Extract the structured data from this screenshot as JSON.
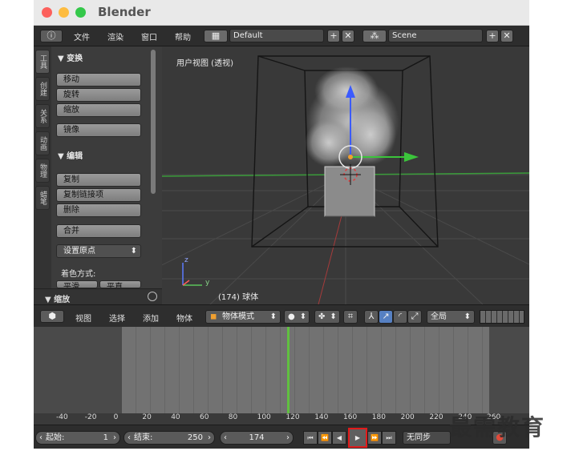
{
  "window": {
    "title": "Blender"
  },
  "info_header": {
    "menus": [
      "文件",
      "渲染",
      "窗口",
      "帮助"
    ],
    "layout": "Default",
    "scene": "Scene"
  },
  "tool_shelf": {
    "tabs": [
      "工具",
      "创建",
      "关系",
      "动画",
      "物理",
      "蜡笔"
    ],
    "transform_panel": {
      "title": "▼ 变换",
      "buttons": [
        "移动",
        "旋转",
        "缩放",
        "镜像"
      ]
    },
    "edit_panel": {
      "title": "▼ 编辑",
      "buttons": [
        "复制",
        "复制链接项",
        "删除",
        "合并"
      ],
      "set_origin": "设置原点",
      "shading_label": "着色方式:",
      "shading_buttons": [
        "平滑",
        "平直"
      ]
    },
    "last_operator": "▼ 缩放"
  },
  "viewport": {
    "view_label": "用户视图 (透视)",
    "object_label": "(174) 球体",
    "axis_z": "z",
    "axis_y": "y"
  },
  "view3d_header": {
    "menus": [
      "视图",
      "选择",
      "添加",
      "物体"
    ],
    "mode": "物体模式",
    "orientation": "全局"
  },
  "timeline": {
    "ticks": [
      "-40",
      "-20",
      "0",
      "20",
      "40",
      "60",
      "80",
      "100",
      "120",
      "140",
      "160",
      "180",
      "200",
      "220",
      "240",
      "260"
    ],
    "start_label": "起始:",
    "start_value": "1",
    "end_label": "结束:",
    "end_value": "250",
    "current_frame": "174",
    "sync": "无同步",
    "current_frame_fraction": 0.45
  },
  "watermark": "最需教育",
  "colors": {
    "selected_tool": "#5680c2",
    "highlight_box": "#e21b1b",
    "frame_cursor": "#60c040",
    "x_axis": "#ff3b3b",
    "y_axis": "#4ec44e",
    "z_axis": "#3b6bff"
  }
}
